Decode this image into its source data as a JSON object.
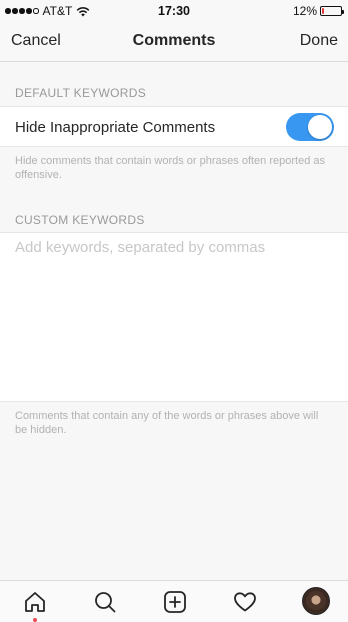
{
  "status_bar": {
    "carrier": "AT&T",
    "time": "17:30",
    "battery_percent": "12%",
    "battery_level": 0.12,
    "signal_bars_filled": 4,
    "signal_bars_total": 5
  },
  "nav": {
    "cancel_label": "Cancel",
    "title": "Comments",
    "done_label": "Done"
  },
  "default_keywords": {
    "header": "DEFAULT KEYWORDS",
    "toggle_label": "Hide Inappropriate Comments",
    "toggle_on": true,
    "toggle_color": "#3897f0",
    "description": "Hide comments that contain words or phrases often reported as offensive."
  },
  "custom_keywords": {
    "header": "CUSTOM KEYWORDS",
    "input_placeholder": "Add keywords, separated by commas",
    "input_value": "",
    "footnote": "Comments that contain any of the words or phrases above will be hidden."
  },
  "tab_bar": {
    "items": [
      {
        "icon": "home-icon",
        "active": true
      },
      {
        "icon": "search-icon",
        "active": false
      },
      {
        "icon": "add-post-icon",
        "active": false
      },
      {
        "icon": "heart-icon",
        "active": false
      },
      {
        "icon": "profile-avatar",
        "active": false
      }
    ],
    "notification_dot_color": "#ed4956"
  }
}
